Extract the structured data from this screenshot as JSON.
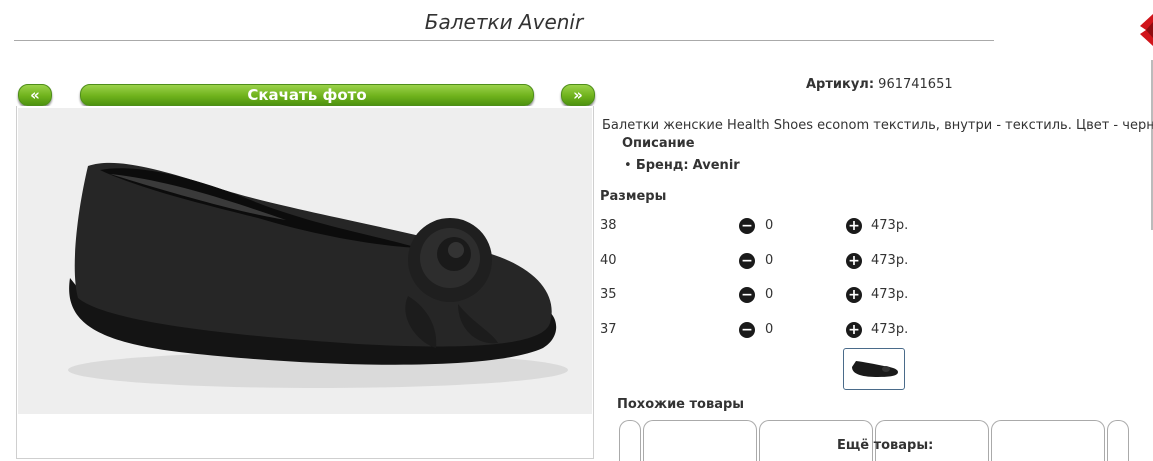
{
  "page": {
    "title": "Балетки Avenir"
  },
  "gallery": {
    "prev_label": "«",
    "download_label": "Скачать фото",
    "next_label": "»"
  },
  "product": {
    "article_label": "Артикул:",
    "article_value": "961741651",
    "description_text": "Балетки женские Health Shoes econom текстиль, внутри - текстиль. Цвет - черный",
    "description_heading": "Описание",
    "brand_label": "Бренд:",
    "brand_value": "Avenir"
  },
  "sizes": {
    "heading": "Размеры",
    "rows": [
      {
        "size": "38",
        "quantity": "0",
        "price": "473р."
      },
      {
        "size": "40",
        "quantity": "0",
        "price": "473р."
      },
      {
        "size": "35",
        "quantity": "0",
        "price": "473р."
      },
      {
        "size": "37",
        "quantity": "0",
        "price": "473р."
      }
    ],
    "minus_icon": "minus-circle-icon",
    "plus_icon": "plus-circle-icon"
  },
  "similar": {
    "heading": "Похожие товары",
    "more_heading": "Ещё товары:"
  },
  "colors": {
    "accent_green": "#6fb21c",
    "close_red": "#d0141a"
  }
}
